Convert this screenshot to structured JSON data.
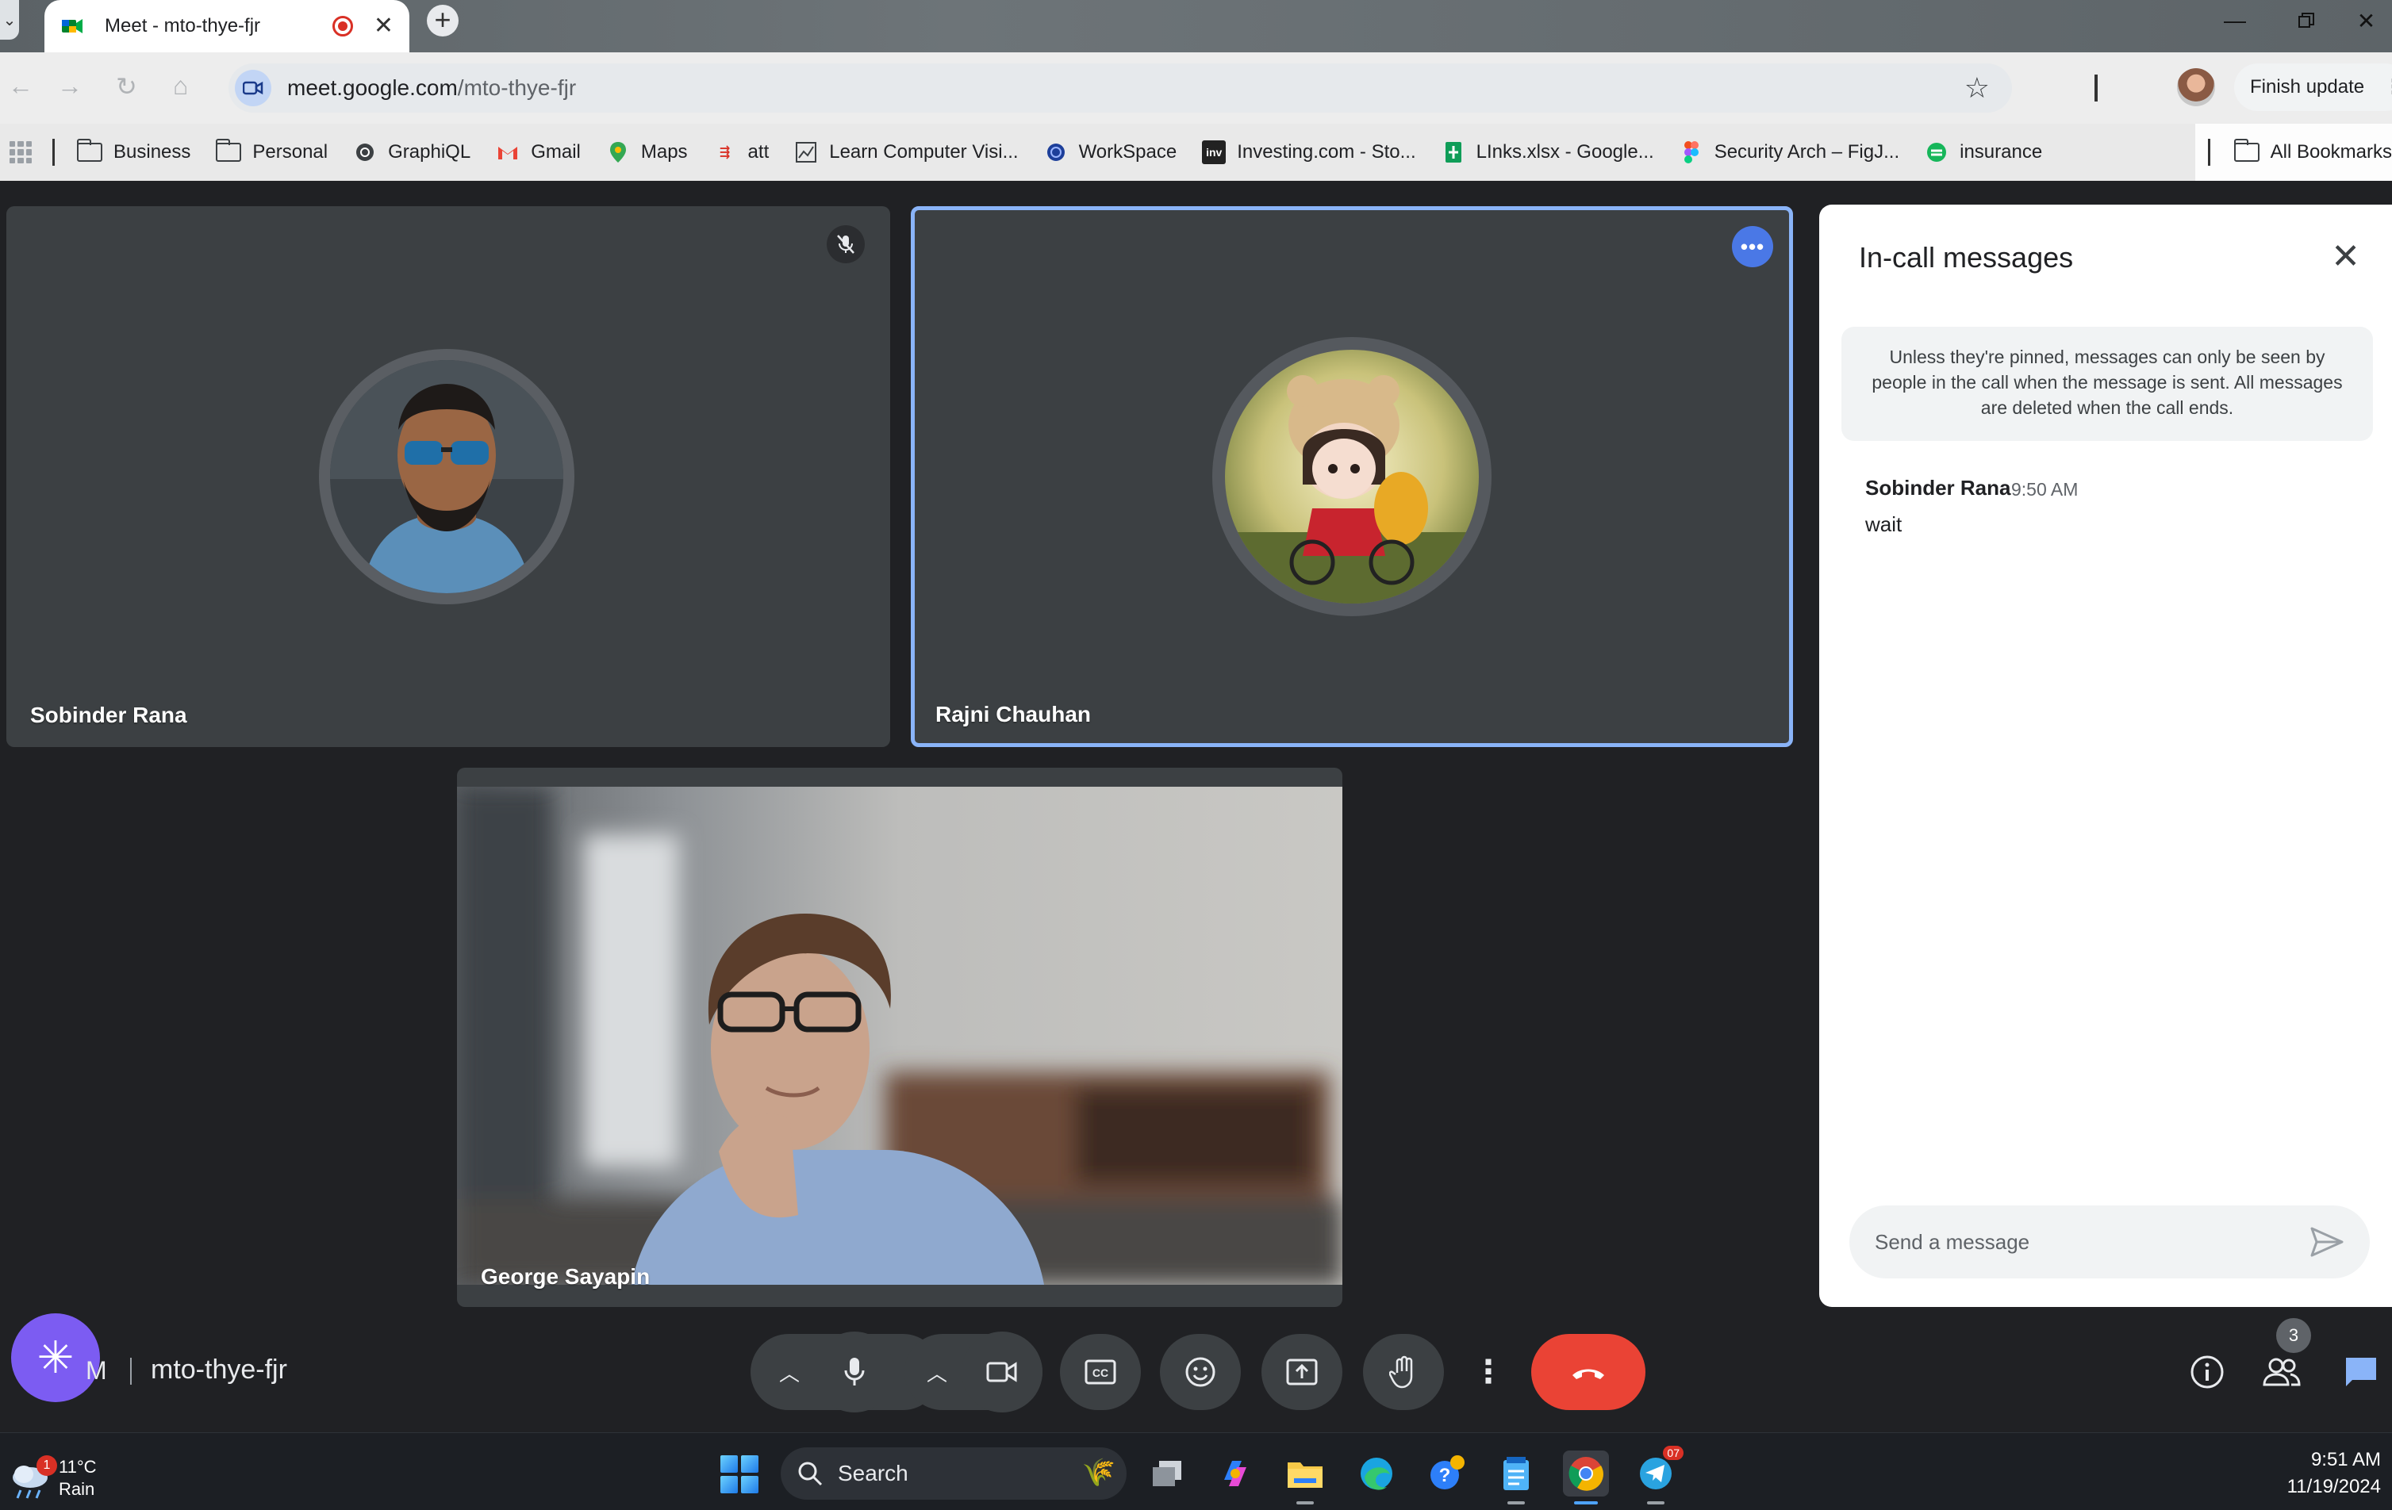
{
  "browser": {
    "tab_title": "Meet - mto-thye-fjr",
    "url_domain": "meet.google.com",
    "url_path": "/mto-thye-fjr",
    "finish_update_label": "Finish update",
    "bookmarks": [
      {
        "label": "Business",
        "icon": "folder-icon"
      },
      {
        "label": "Personal",
        "icon": "folder-icon"
      },
      {
        "label": "GraphiQL",
        "icon": "graphiql-icon"
      },
      {
        "label": "Gmail",
        "icon": "gmail-icon"
      },
      {
        "label": "Maps",
        "icon": "maps-icon"
      },
      {
        "label": "att",
        "icon": "att-icon"
      },
      {
        "label": "Learn Computer Visi...",
        "icon": "chart-icon"
      },
      {
        "label": "WorkSpace",
        "icon": "workspace-icon"
      },
      {
        "label": "Investing.com - Sto...",
        "icon": "investing-icon"
      },
      {
        "label": "LInks.xlsx - Google...",
        "icon": "sheets-icon"
      },
      {
        "label": "Security Arch – FigJ...",
        "icon": "figma-icon"
      },
      {
        "label": "insurance",
        "icon": "insurance-icon"
      }
    ],
    "all_bookmarks_label": "All Bookmarks"
  },
  "meet": {
    "participants": [
      {
        "name": "Sobinder Rana",
        "muted": true
      },
      {
        "name": "Rajni Chauhan",
        "active_speaker": true
      },
      {
        "name": "George Sayapin",
        "video_on": true
      }
    ],
    "time_partial": "M",
    "meeting_code": "mto-thye-fjr",
    "people_count": "3"
  },
  "chat": {
    "title": "In-call messages",
    "info": "Unless they're pinned, messages can only be seen by people in the call when the message is sent. All messages are deleted when the call ends.",
    "messages": [
      {
        "sender": "Sobinder Rana",
        "time": "9:50 AM",
        "text": "wait"
      }
    ],
    "input_placeholder": "Send a message"
  },
  "taskbar": {
    "weather_temp": "11°C",
    "weather_desc": "Rain",
    "weather_badge": "1",
    "search_label": "Search",
    "telegram_badge": "07",
    "time": "9:51 AM",
    "date": "11/19/2024"
  },
  "colors": {
    "meet_bg": "#202124",
    "tile_bg": "#3c4043",
    "active_border": "#8ab4f8",
    "end_call": "#ea4335",
    "gemini": "#7c5cf2"
  }
}
